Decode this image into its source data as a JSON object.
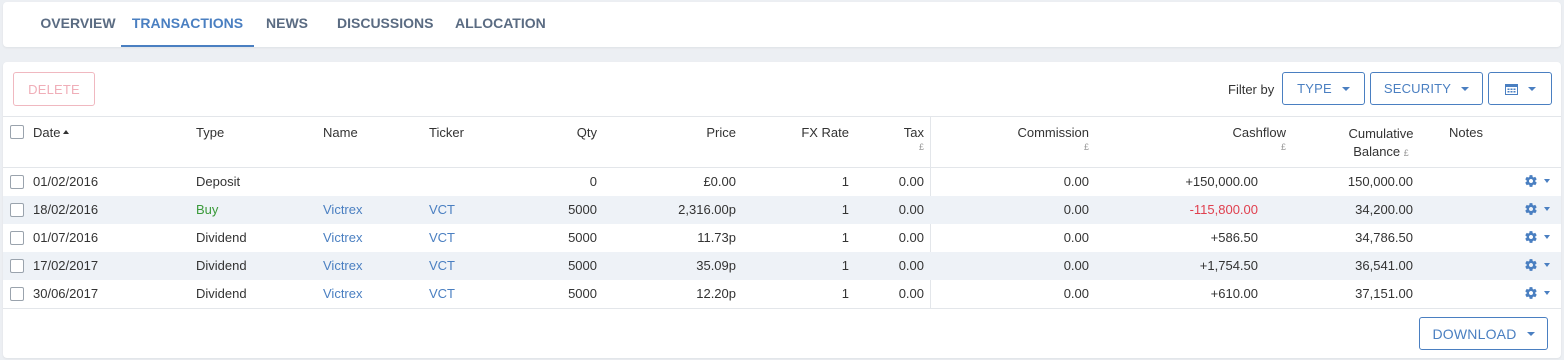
{
  "tabs": [
    {
      "label": "OVERVIEW",
      "active": false
    },
    {
      "label": "TRANSACTIONS",
      "active": true
    },
    {
      "label": "NEWS",
      "active": false
    },
    {
      "label": "DISCUSSIONS",
      "active": false
    },
    {
      "label": "ALLOCATION",
      "active": false
    }
  ],
  "toolbar": {
    "delete_label": "DELETE",
    "filter_label": "Filter by",
    "type_label": "TYPE",
    "security_label": "SECURITY",
    "calendar_icon": "calendar-icon"
  },
  "colors": {
    "accent": "#4a7fc1",
    "buy": "#3a9a3a",
    "negative": "#e0404f",
    "disabled": "#f0aeb8",
    "row_alt": "#eef2f7"
  },
  "table": {
    "columns": {
      "date": "Date",
      "type": "Type",
      "name": "Name",
      "ticker": "Ticker",
      "qty": "Qty",
      "price": "Price",
      "fx_rate": "FX Rate",
      "tax": "Tax",
      "tax_unit": "£",
      "commission": "Commission",
      "commission_unit": "£",
      "cashflow": "Cashflow",
      "cashflow_unit": "£",
      "cumulative_line1": "Cumulative",
      "cumulative_line2": "Balance",
      "cumulative_unit": "£",
      "notes": "Notes"
    },
    "sort": {
      "column": "Date",
      "direction": "ascending"
    },
    "rows": [
      {
        "date": "01/02/2016",
        "type": "Deposit",
        "name": "",
        "ticker": "",
        "qty": "0",
        "price": "£0.00",
        "fx_rate": "1",
        "tax": "0.00",
        "commission": "0.00",
        "cashflow": "+150,000.00",
        "cumulative": "150,000.00"
      },
      {
        "date": "18/02/2016",
        "type": "Buy",
        "name": "Victrex",
        "ticker": "VCT",
        "qty": "5000",
        "price": "2,316.00p",
        "fx_rate": "1",
        "tax": "0.00",
        "commission": "0.00",
        "cashflow": "-115,800.00",
        "cumulative": "34,200.00"
      },
      {
        "date": "01/07/2016",
        "type": "Dividend",
        "name": "Victrex",
        "ticker": "VCT",
        "qty": "5000",
        "price": "11.73p",
        "fx_rate": "1",
        "tax": "0.00",
        "commission": "0.00",
        "cashflow": "+586.50",
        "cumulative": "34,786.50"
      },
      {
        "date": "17/02/2017",
        "type": "Dividend",
        "name": "Victrex",
        "ticker": "VCT",
        "qty": "5000",
        "price": "35.09p",
        "fx_rate": "1",
        "tax": "0.00",
        "commission": "0.00",
        "cashflow": "+1,754.50",
        "cumulative": "36,541.00"
      },
      {
        "date": "30/06/2017",
        "type": "Dividend",
        "name": "Victrex",
        "ticker": "VCT",
        "qty": "5000",
        "price": "12.20p",
        "fx_rate": "1",
        "tax": "0.00",
        "commission": "0.00",
        "cashflow": "+610.00",
        "cumulative": "37,151.00"
      }
    ]
  },
  "footer": {
    "download_label": "DOWNLOAD"
  }
}
